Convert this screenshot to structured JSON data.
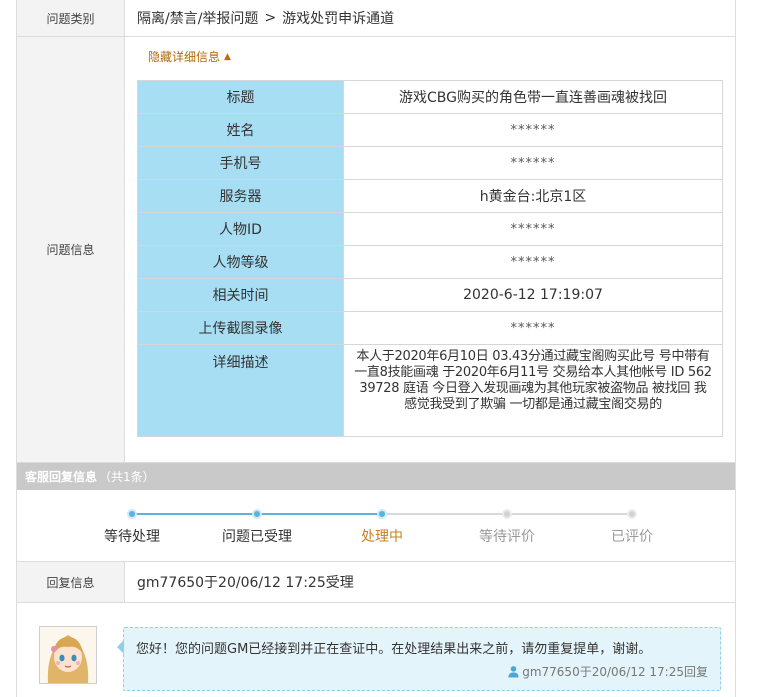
{
  "category": {
    "label": "问题类别",
    "path": "隔离/禁言/举报问题",
    "separator": ">",
    "channel": "游戏处罚申诉通道"
  },
  "issue_info": {
    "label": "问题信息",
    "toggle_label": "隐藏详细信息",
    "fields": [
      {
        "key": "标题",
        "value": "游戏CBG购买的角色带一直连善画魂被找回"
      },
      {
        "key": "姓名",
        "value": "******"
      },
      {
        "key": "手机号",
        "value": "******"
      },
      {
        "key": "服务器",
        "value": "h黄金台:北京1区"
      },
      {
        "key": "人物ID",
        "value": "******"
      },
      {
        "key": "人物等级",
        "value": "******"
      },
      {
        "key": "相关时间",
        "value": "2020-6-12 17:19:07"
      },
      {
        "key": "上传截图录像",
        "value": "******"
      }
    ],
    "description": {
      "key": "详细描述",
      "value": "本人于2020年6月10日 03.43分通过藏宝阁购买此号 号中带有一直8技能画魂 于2020年6月11号 交易给本人其他帐号 ID 56239728 庭语 今日登入发现画魂为其他玩家被盗物品 被找回 我感觉我受到了欺骗 一切都是通过藏宝阁交易的"
    }
  },
  "service_reply": {
    "title": "客服回复信息",
    "count": "（共1条）"
  },
  "progress": {
    "current_index": 2,
    "steps": [
      "等待处理",
      "问题已受理",
      "处理中",
      "等待评价",
      "已评价"
    ],
    "colors": {
      "done": "#5bb3dd",
      "current_text": "#c8801f",
      "done_text": "#333333",
      "todo_text": "#999999",
      "todo_track": "#d9d9d9"
    }
  },
  "reply_info": {
    "label": "回复信息",
    "value": "gm77650于20/06/12 17:25受理"
  },
  "reply_message": {
    "text": "您好！您的问题GM已经接到并正在查证中。在处理结果出来之前，请勿重复提单，谢谢。",
    "meta": "gm77650于20/06/12 17:25回复"
  }
}
